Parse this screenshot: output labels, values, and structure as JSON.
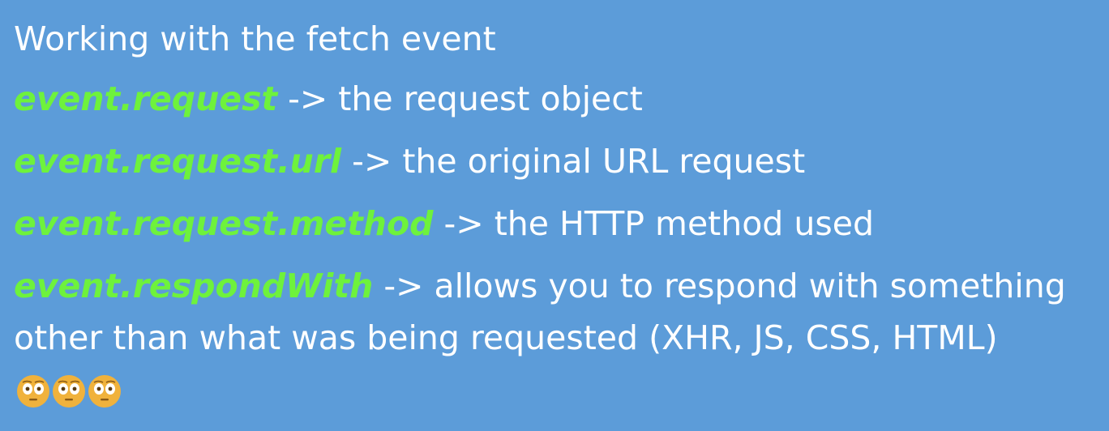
{
  "title": "Working with the fetch event",
  "items": [
    {
      "code": "event.request",
      "text": "-> the request object"
    },
    {
      "code": "event.request.url",
      "text": "-> the original URL request"
    },
    {
      "code": "event.request.method",
      "text": "-> the HTTP method used"
    },
    {
      "code": "event.respondWith",
      "text": "-> allows you to respond with something other than what was being requested (XHR, JS, CSS, HTML)"
    }
  ],
  "emojis": [
    "flushed-face-icon",
    "flushed-face-icon",
    "flushed-face-icon"
  ],
  "colors": {
    "background": "#5c9cd9",
    "text": "#ffffff",
    "code": "#6ef23c",
    "emoji": "#f0b23c"
  }
}
